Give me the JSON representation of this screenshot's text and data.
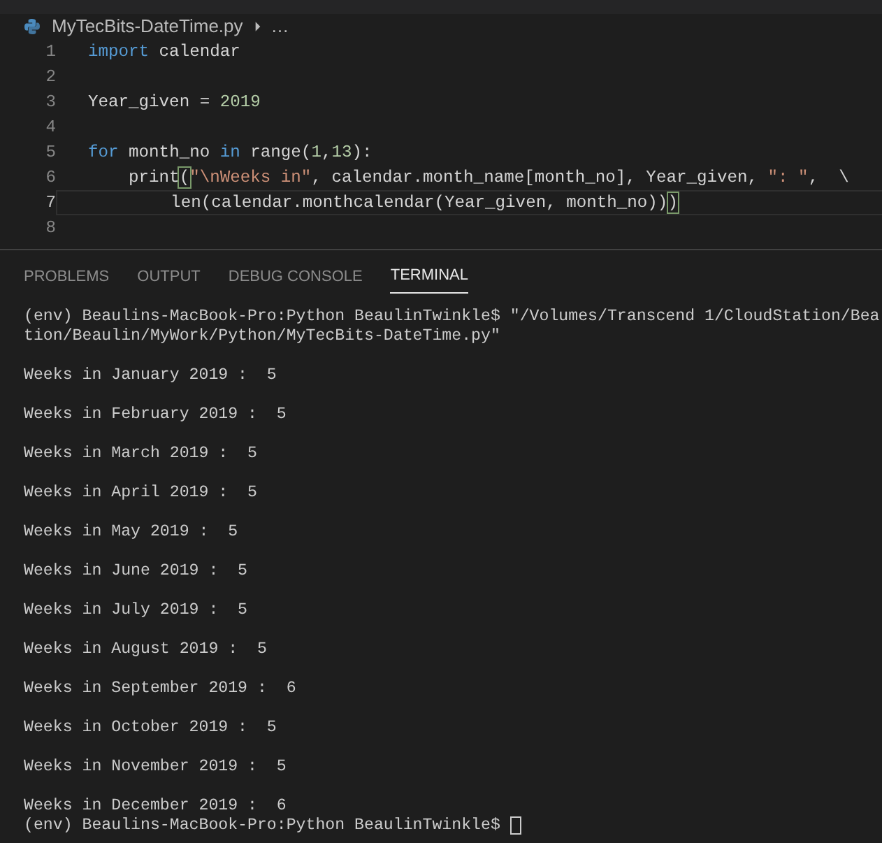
{
  "breadcrumb": {
    "file": "MyTecBits-DateTime.py",
    "more": "…"
  },
  "editor": {
    "lines": [
      {
        "number": "1",
        "current": false,
        "tokens": [
          {
            "kind": "keyword",
            "text": "import"
          },
          {
            "kind": "plain",
            "text": " calendar"
          }
        ]
      },
      {
        "number": "2",
        "current": false
      },
      {
        "number": "3",
        "current": false,
        "tokens": [
          {
            "kind": "plain",
            "text": "Year_given = "
          },
          {
            "kind": "number",
            "text": "2019"
          }
        ]
      },
      {
        "number": "4",
        "current": false
      },
      {
        "number": "5",
        "current": false,
        "tokens": [
          {
            "kind": "keyword",
            "text": "for"
          },
          {
            "kind": "plain",
            "text": " month_no "
          },
          {
            "kind": "keyword",
            "text": "in"
          },
          {
            "kind": "plain",
            "text": " range("
          },
          {
            "kind": "number",
            "text": "1"
          },
          {
            "kind": "plain",
            "text": ","
          },
          {
            "kind": "number",
            "text": "13"
          },
          {
            "kind": "plain",
            "text": "):"
          }
        ]
      },
      {
        "number": "6",
        "current": false,
        "tokens": [
          {
            "kind": "plain",
            "text": "    print"
          },
          {
            "kind": "bracket",
            "text": "("
          },
          {
            "kind": "string",
            "text": "\"\\nWeeks in\""
          },
          {
            "kind": "plain",
            "text": ", calendar.month_name[month_no], Year_given, "
          },
          {
            "kind": "string",
            "text": "\": \""
          },
          {
            "kind": "plain",
            "text": ",  \\"
          }
        ]
      },
      {
        "number": "7",
        "current": true,
        "tokens": [
          {
            "kind": "plain",
            "text": "        len(calendar.monthcalendar(Year_given, month_no))"
          },
          {
            "kind": "bracket",
            "text": ")"
          }
        ]
      },
      {
        "number": "8",
        "current": false
      }
    ]
  },
  "panel_tabs": [
    {
      "label": "PROBLEMS",
      "selected": false
    },
    {
      "label": "OUTPUT",
      "selected": false
    },
    {
      "label": "DEBUG CONSOLE",
      "selected": false
    },
    {
      "label": "TERMINAL",
      "selected": true
    }
  ],
  "terminal": [
    {
      "kind": "command",
      "text": "(env) Beaulins-MacBook-Pro:Python BeaulinTwinkle$ \"/Volumes/Transcend 1/CloudStation/Bea"
    },
    {
      "kind": "continuation",
      "text": "tion/Beaulin/MyWork/Python/MyTecBits-DateTime.py\""
    },
    {
      "kind": "result",
      "text": "Weeks in January 2019 :  5"
    },
    {
      "kind": "result",
      "text": "Weeks in February 2019 :  5"
    },
    {
      "kind": "result",
      "text": "Weeks in March 2019 :  5"
    },
    {
      "kind": "result",
      "text": "Weeks in April 2019 :  5"
    },
    {
      "kind": "result",
      "text": "Weeks in May 2019 :  5"
    },
    {
      "kind": "result",
      "text": "Weeks in June 2019 :  5"
    },
    {
      "kind": "result",
      "text": "Weeks in July 2019 :  5"
    },
    {
      "kind": "result",
      "text": "Weeks in August 2019 :  5"
    },
    {
      "kind": "result",
      "text": "Weeks in September 2019 :  6"
    },
    {
      "kind": "result",
      "text": "Weeks in October 2019 :  5"
    },
    {
      "kind": "result",
      "text": "Weeks in November 2019 :  5"
    },
    {
      "kind": "result",
      "text": "Weeks in December 2019 :  6"
    },
    {
      "kind": "prompt",
      "text": "(env) Beaulins-MacBook-Pro:Python BeaulinTwinkle$"
    }
  ]
}
